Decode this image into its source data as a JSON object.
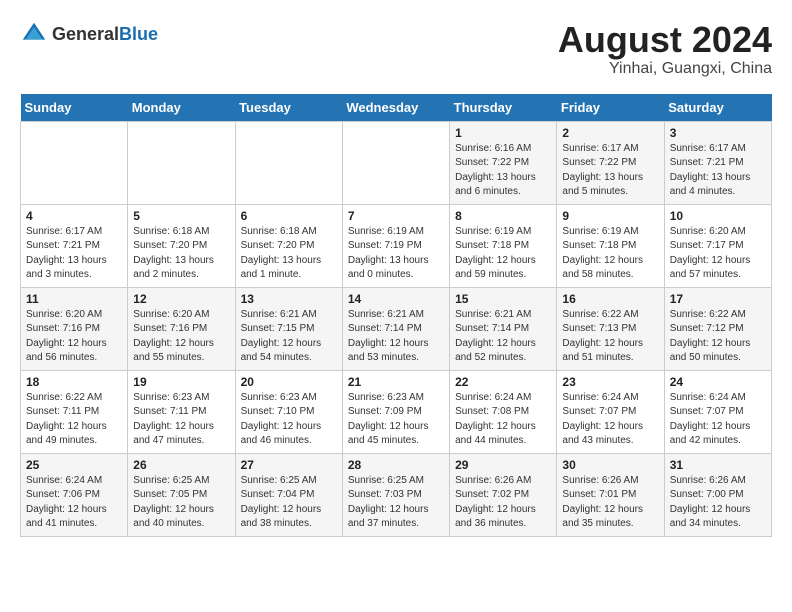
{
  "header": {
    "logo_general": "General",
    "logo_blue": "Blue",
    "month_year": "August 2024",
    "location": "Yinhai, Guangxi, China"
  },
  "days_of_week": [
    "Sunday",
    "Monday",
    "Tuesday",
    "Wednesday",
    "Thursday",
    "Friday",
    "Saturday"
  ],
  "weeks": [
    [
      {
        "day": "",
        "info": ""
      },
      {
        "day": "",
        "info": ""
      },
      {
        "day": "",
        "info": ""
      },
      {
        "day": "",
        "info": ""
      },
      {
        "day": "1",
        "info": "Sunrise: 6:16 AM\nSunset: 7:22 PM\nDaylight: 13 hours\nand 6 minutes."
      },
      {
        "day": "2",
        "info": "Sunrise: 6:17 AM\nSunset: 7:22 PM\nDaylight: 13 hours\nand 5 minutes."
      },
      {
        "day": "3",
        "info": "Sunrise: 6:17 AM\nSunset: 7:21 PM\nDaylight: 13 hours\nand 4 minutes."
      }
    ],
    [
      {
        "day": "4",
        "info": "Sunrise: 6:17 AM\nSunset: 7:21 PM\nDaylight: 13 hours\nand 3 minutes."
      },
      {
        "day": "5",
        "info": "Sunrise: 6:18 AM\nSunset: 7:20 PM\nDaylight: 13 hours\nand 2 minutes."
      },
      {
        "day": "6",
        "info": "Sunrise: 6:18 AM\nSunset: 7:20 PM\nDaylight: 13 hours\nand 1 minute."
      },
      {
        "day": "7",
        "info": "Sunrise: 6:19 AM\nSunset: 7:19 PM\nDaylight: 13 hours\nand 0 minutes."
      },
      {
        "day": "8",
        "info": "Sunrise: 6:19 AM\nSunset: 7:18 PM\nDaylight: 12 hours\nand 59 minutes."
      },
      {
        "day": "9",
        "info": "Sunrise: 6:19 AM\nSunset: 7:18 PM\nDaylight: 12 hours\nand 58 minutes."
      },
      {
        "day": "10",
        "info": "Sunrise: 6:20 AM\nSunset: 7:17 PM\nDaylight: 12 hours\nand 57 minutes."
      }
    ],
    [
      {
        "day": "11",
        "info": "Sunrise: 6:20 AM\nSunset: 7:16 PM\nDaylight: 12 hours\nand 56 minutes."
      },
      {
        "day": "12",
        "info": "Sunrise: 6:20 AM\nSunset: 7:16 PM\nDaylight: 12 hours\nand 55 minutes."
      },
      {
        "day": "13",
        "info": "Sunrise: 6:21 AM\nSunset: 7:15 PM\nDaylight: 12 hours\nand 54 minutes."
      },
      {
        "day": "14",
        "info": "Sunrise: 6:21 AM\nSunset: 7:14 PM\nDaylight: 12 hours\nand 53 minutes."
      },
      {
        "day": "15",
        "info": "Sunrise: 6:21 AM\nSunset: 7:14 PM\nDaylight: 12 hours\nand 52 minutes."
      },
      {
        "day": "16",
        "info": "Sunrise: 6:22 AM\nSunset: 7:13 PM\nDaylight: 12 hours\nand 51 minutes."
      },
      {
        "day": "17",
        "info": "Sunrise: 6:22 AM\nSunset: 7:12 PM\nDaylight: 12 hours\nand 50 minutes."
      }
    ],
    [
      {
        "day": "18",
        "info": "Sunrise: 6:22 AM\nSunset: 7:11 PM\nDaylight: 12 hours\nand 49 minutes."
      },
      {
        "day": "19",
        "info": "Sunrise: 6:23 AM\nSunset: 7:11 PM\nDaylight: 12 hours\nand 47 minutes."
      },
      {
        "day": "20",
        "info": "Sunrise: 6:23 AM\nSunset: 7:10 PM\nDaylight: 12 hours\nand 46 minutes."
      },
      {
        "day": "21",
        "info": "Sunrise: 6:23 AM\nSunset: 7:09 PM\nDaylight: 12 hours\nand 45 minutes."
      },
      {
        "day": "22",
        "info": "Sunrise: 6:24 AM\nSunset: 7:08 PM\nDaylight: 12 hours\nand 44 minutes."
      },
      {
        "day": "23",
        "info": "Sunrise: 6:24 AM\nSunset: 7:07 PM\nDaylight: 12 hours\nand 43 minutes."
      },
      {
        "day": "24",
        "info": "Sunrise: 6:24 AM\nSunset: 7:07 PM\nDaylight: 12 hours\nand 42 minutes."
      }
    ],
    [
      {
        "day": "25",
        "info": "Sunrise: 6:24 AM\nSunset: 7:06 PM\nDaylight: 12 hours\nand 41 minutes."
      },
      {
        "day": "26",
        "info": "Sunrise: 6:25 AM\nSunset: 7:05 PM\nDaylight: 12 hours\nand 40 minutes."
      },
      {
        "day": "27",
        "info": "Sunrise: 6:25 AM\nSunset: 7:04 PM\nDaylight: 12 hours\nand 38 minutes."
      },
      {
        "day": "28",
        "info": "Sunrise: 6:25 AM\nSunset: 7:03 PM\nDaylight: 12 hours\nand 37 minutes."
      },
      {
        "day": "29",
        "info": "Sunrise: 6:26 AM\nSunset: 7:02 PM\nDaylight: 12 hours\nand 36 minutes."
      },
      {
        "day": "30",
        "info": "Sunrise: 6:26 AM\nSunset: 7:01 PM\nDaylight: 12 hours\nand 35 minutes."
      },
      {
        "day": "31",
        "info": "Sunrise: 6:26 AM\nSunset: 7:00 PM\nDaylight: 12 hours\nand 34 minutes."
      }
    ]
  ]
}
